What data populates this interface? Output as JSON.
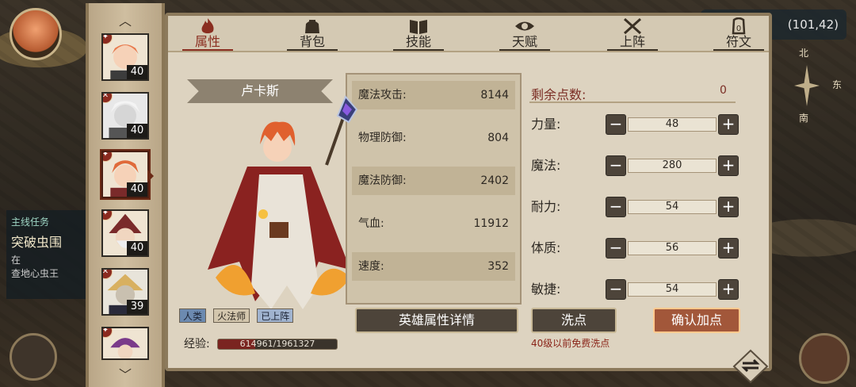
{
  "background": {
    "quest_title": "主线任务",
    "quest_name": "突破虫围",
    "quest_desc_1": "在",
    "quest_desc_2": "查地心虫王",
    "coordinates": "(101,42)",
    "compass": {
      "north": "北",
      "east": "东",
      "south": "南"
    }
  },
  "roster": {
    "heroes": [
      {
        "level": "40",
        "hair": "#e8794c"
      },
      {
        "level": "40",
        "hair": "#e8e8e8"
      },
      {
        "level": "40",
        "hair": "#e06a3a",
        "selected": true
      },
      {
        "level": "40",
        "hair": "#8a2a2a"
      },
      {
        "level": "39",
        "hair": "#d8b060"
      },
      {
        "level": "",
        "hair": "#7a3a8a"
      }
    ]
  },
  "tabs": [
    {
      "label": "属性",
      "icon": "fire-icon",
      "active": true
    },
    {
      "label": "背包",
      "icon": "bag-icon"
    },
    {
      "label": "技能",
      "icon": "book-icon"
    },
    {
      "label": "天赋",
      "icon": "eye-icon"
    },
    {
      "label": "上阵",
      "icon": "crossed-swords-icon"
    },
    {
      "label": "符文",
      "icon": "rune-icon"
    }
  ],
  "hero": {
    "name": "卢卡斯",
    "tags": {
      "race": "人类",
      "class": "火法师",
      "status": "已上阵"
    },
    "exp_label": "经验:",
    "exp_text": "614961/1961327",
    "exp_fraction": 0.3135
  },
  "stats": [
    {
      "name": "魔法攻击:",
      "value": "8144"
    },
    {
      "name": "物理防御:",
      "value": "804"
    },
    {
      "name": "魔法防御:",
      "value": "2402"
    },
    {
      "name": "气血:",
      "value": "11912"
    },
    {
      "name": "速度:",
      "value": "352"
    }
  ],
  "detail_button": "英雄属性详情",
  "allocation": {
    "remaining_label": "剩余点数:",
    "remaining_value": "0",
    "rows": [
      {
        "name": "力量:",
        "value": "48"
      },
      {
        "name": "魔法:",
        "value": "280"
      },
      {
        "name": "耐力:",
        "value": "54"
      },
      {
        "name": "体质:",
        "value": "56"
      },
      {
        "name": "敏捷:",
        "value": "54"
      }
    ],
    "minus": "−",
    "plus": "+"
  },
  "reset_button": "洗点",
  "reset_note": "40级以前免费洗点",
  "confirm_button": "确认加点",
  "colors": {
    "accent_red": "#8a2e20",
    "panel_bg": "#ddd3c0",
    "button_dark": "#4d443a",
    "confirm": "#a2573a"
  }
}
